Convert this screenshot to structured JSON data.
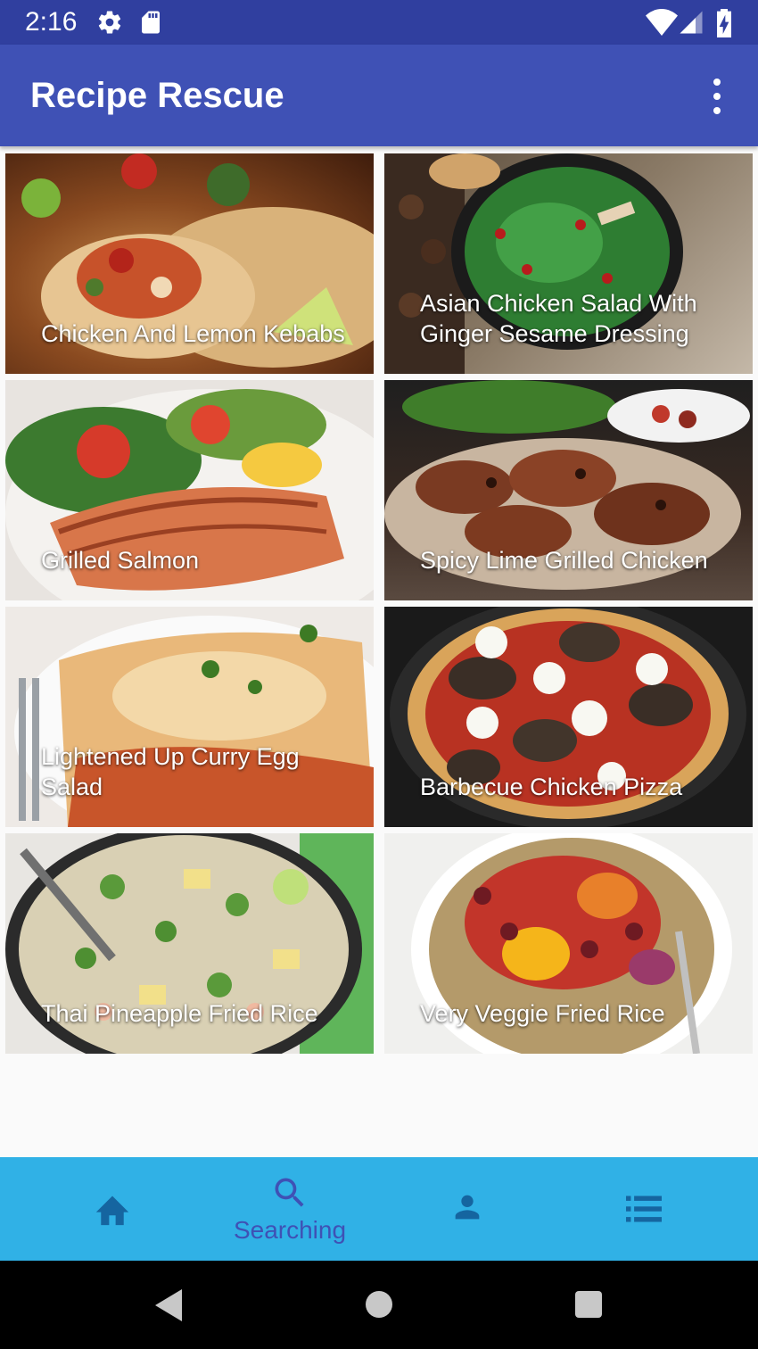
{
  "status_bar": {
    "time": "2:16"
  },
  "app_bar": {
    "title": "Recipe Rescue"
  },
  "recipes": [
    {
      "title": "Chicken And Lemon Kebabs"
    },
    {
      "title": "Asian Chicken Salad With Ginger Sesame Dressing"
    },
    {
      "title": "Grilled Salmon"
    },
    {
      "title": "Spicy Lime Grilled Chicken"
    },
    {
      "title": "Lightened Up Curry Egg Salad"
    },
    {
      "title": "Barbecue Chicken Pizza"
    },
    {
      "title": "Thai Pineapple Fried Rice"
    },
    {
      "title": "Very Veggie Fried Rice"
    }
  ],
  "bottom_nav": {
    "items": [
      {
        "icon": "home-icon",
        "label": ""
      },
      {
        "icon": "search-icon",
        "label": "Searching"
      },
      {
        "icon": "person-icon",
        "label": ""
      },
      {
        "icon": "list-icon",
        "label": ""
      }
    ],
    "selected": 1
  },
  "colors": {
    "status_bar": "#303f9f",
    "app_bar": "#3f51b5",
    "bottom_nav": "#30b1e6",
    "nav_active": "#3f51b5",
    "nav_inactive": "#1565a0"
  }
}
